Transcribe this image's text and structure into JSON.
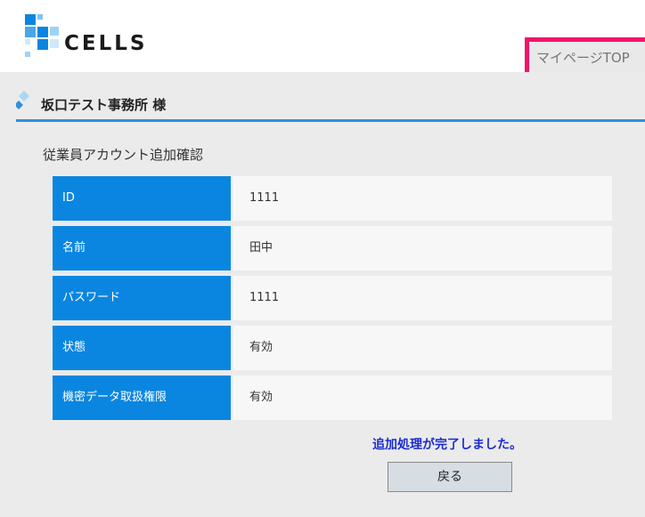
{
  "header": {
    "logo_text": "CELLS",
    "mypage_link": "マイページTOP"
  },
  "subheader": {
    "office_name": "坂口テスト事務所 様"
  },
  "main": {
    "title": "従業員アカウント追加確認",
    "rows": [
      {
        "label": "ID",
        "value": "1111"
      },
      {
        "label": "名前",
        "value": "田中"
      },
      {
        "label": "パスワード",
        "value": "1111"
      },
      {
        "label": "状態",
        "value": "有効"
      },
      {
        "label": "機密データ取扱権限",
        "value": "有効"
      }
    ],
    "completion_message": "追加処理が完了しました。",
    "back_button": "戻る"
  },
  "colors": {
    "label_bg": "#0a86e0",
    "accent_line": "#2f8fe0",
    "highlight_border": "#f2136a",
    "message_text": "#1a2bd0"
  }
}
